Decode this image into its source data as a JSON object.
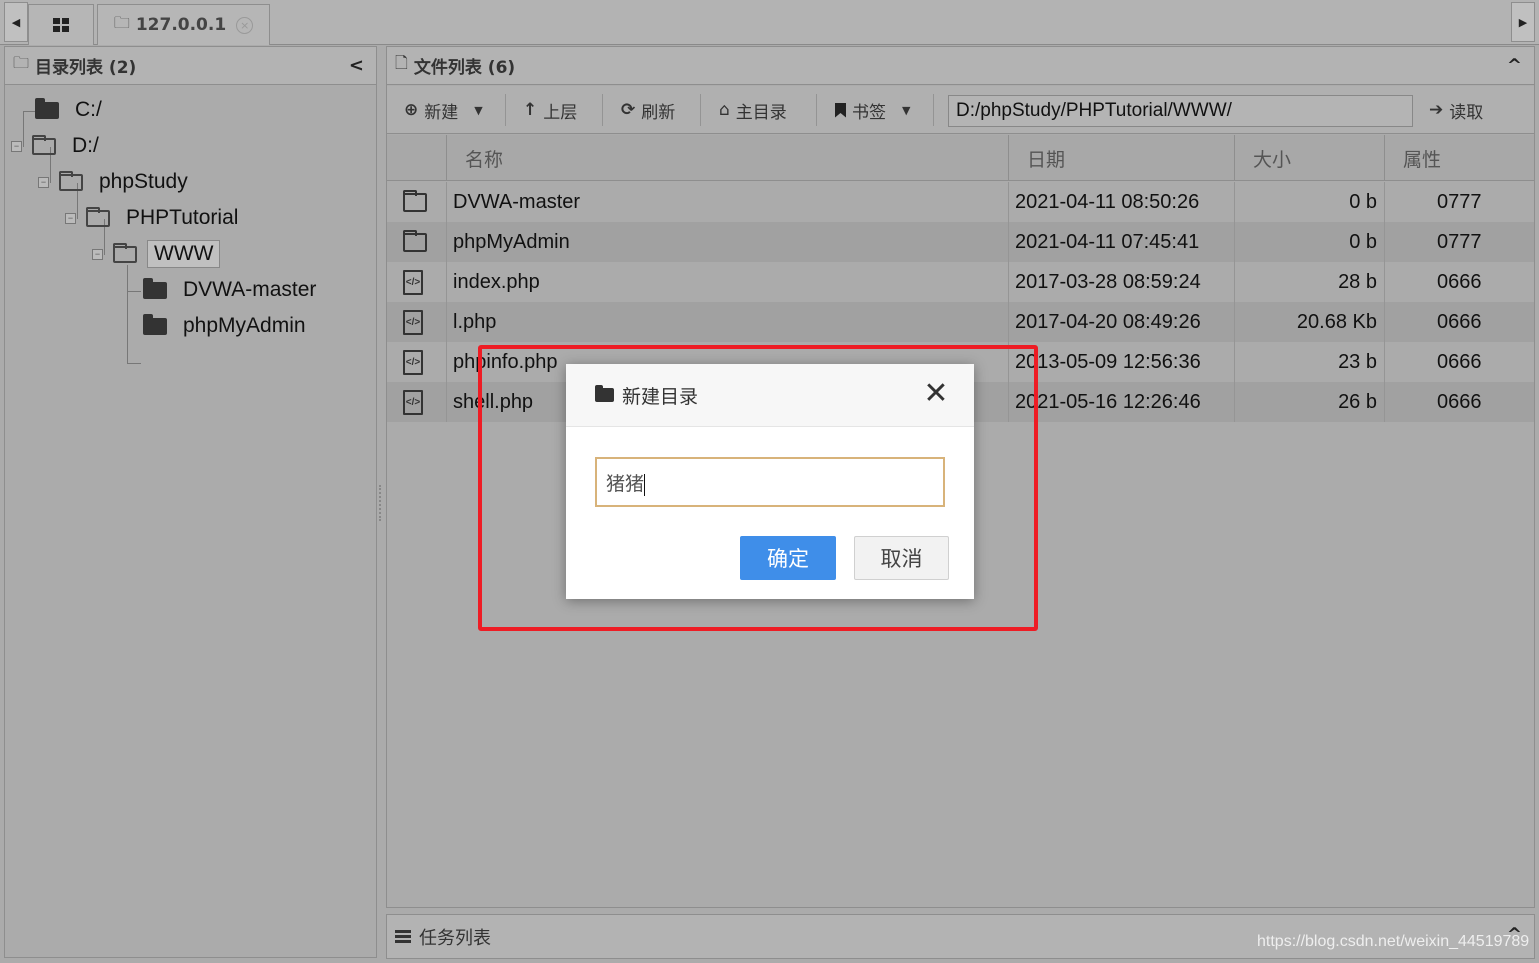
{
  "tabs": {
    "host_label": "127.0.0.1",
    "close_glyph": "×"
  },
  "left_panel": {
    "title": "目录列表 (2)",
    "tree": [
      {
        "label": "C:/",
        "icon": "folder-closed-icon"
      },
      {
        "label": "D:/",
        "icon": "folder-open-icon"
      },
      {
        "label": "phpStudy",
        "icon": "folder-open-icon"
      },
      {
        "label": "PHPTutorial",
        "icon": "folder-open-icon"
      },
      {
        "label": "WWW",
        "icon": "folder-open-icon",
        "selected": true
      },
      {
        "label": "DVWA-master",
        "icon": "folder-closed-icon"
      },
      {
        "label": "phpMyAdmin",
        "icon": "folder-closed-icon"
      }
    ]
  },
  "right_panel": {
    "title": "文件列表 (6)",
    "toolbar": {
      "new_label": "新建",
      "up_label": "上层",
      "refresh_label": "刷新",
      "home_label": "主目录",
      "bookmark_label": "书签",
      "path_value": "D:/phpStudy/PHPTutorial/WWW/",
      "read_label": "读取"
    },
    "columns": [
      "名称",
      "日期",
      "大小",
      "属性"
    ],
    "files": [
      {
        "name": "DVWA-master",
        "date": "2021-04-11 08:50:26",
        "size": "0 b",
        "attr": "0777",
        "type": "folder"
      },
      {
        "name": "phpMyAdmin",
        "date": "2021-04-11 07:45:41",
        "size": "0 b",
        "attr": "0777",
        "type": "folder"
      },
      {
        "name": "index.php",
        "date": "2017-03-28 08:59:24",
        "size": "28 b",
        "attr": "0666",
        "type": "code"
      },
      {
        "name": "l.php",
        "date": "2017-04-20 08:49:26",
        "size": "20.68 Kb",
        "attr": "0666",
        "type": "code"
      },
      {
        "name": "phpinfo.php",
        "date": "2013-05-09 12:56:36",
        "size": "23 b",
        "attr": "0666",
        "type": "code"
      },
      {
        "name": "shell.php",
        "date": "2021-05-16 12:26:46",
        "size": "26 b",
        "attr": "0666",
        "type": "code"
      }
    ]
  },
  "task_panel": {
    "title": "任务列表"
  },
  "dialog": {
    "title": "新建目录",
    "input_value": "猪猪",
    "ok_label": "确定",
    "cancel_label": "取消",
    "close_glyph": "✕"
  },
  "watermark": "https://blog.csdn.net/weixin_44519789",
  "colors": {
    "accent": "#3f8ee9",
    "highlight": "#ee1c24",
    "input_border": "#d8b37a"
  }
}
